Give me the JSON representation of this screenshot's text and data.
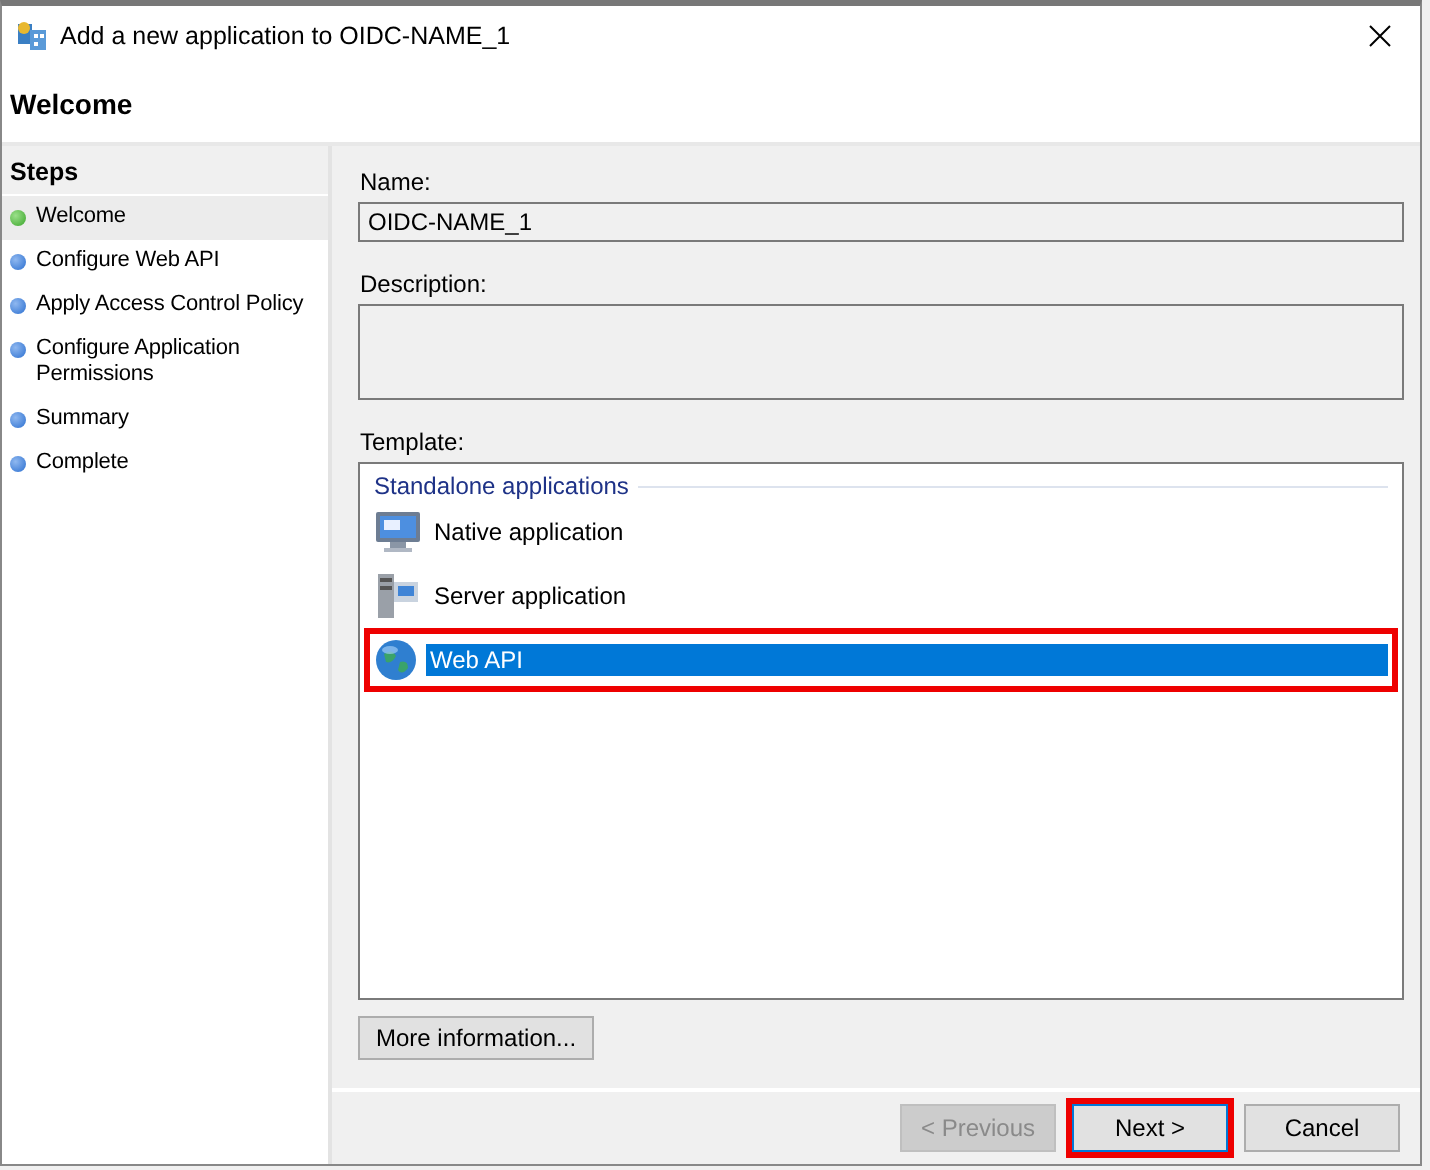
{
  "window": {
    "title": "Add a new application to OIDC-NAME_1"
  },
  "header": {
    "title": "Welcome"
  },
  "sidebar": {
    "title": "Steps",
    "items": [
      {
        "label": "Welcome",
        "selected": true
      },
      {
        "label": "Configure Web API",
        "selected": false
      },
      {
        "label": "Apply Access Control Policy",
        "selected": false
      },
      {
        "label": "Configure Application Permissions",
        "selected": false
      },
      {
        "label": "Summary",
        "selected": false
      },
      {
        "label": "Complete",
        "selected": false
      }
    ]
  },
  "form": {
    "name_label": "Name:",
    "name_value": "OIDC-NAME_1",
    "description_label": "Description:",
    "template_label": "Template:"
  },
  "template": {
    "group": "Standalone applications",
    "items": [
      {
        "label": "Native application",
        "kind": "native",
        "selected": false,
        "highlighted": false
      },
      {
        "label": "Server application",
        "kind": "server",
        "selected": false,
        "highlighted": false
      },
      {
        "label": "Web API",
        "kind": "web",
        "selected": true,
        "highlighted": true
      }
    ]
  },
  "more_info_button": "More information...",
  "buttons": [
    {
      "label": "< Previous",
      "disabled": true,
      "highlighted": false
    },
    {
      "label": "Next >",
      "disabled": false,
      "highlighted": true
    },
    {
      "label": "Cancel",
      "disabled": false,
      "highlighted": false
    }
  ]
}
